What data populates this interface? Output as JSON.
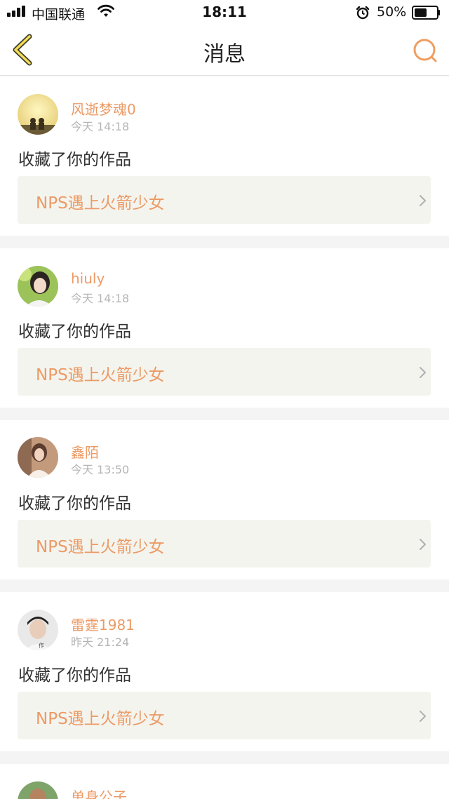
{
  "status_bar": {
    "carrier": "中国联通",
    "time": "18:11",
    "battery": "50%",
    "battery_level": 0.5
  },
  "nav": {
    "title": "消息",
    "back_icon": "back-chevron-icon",
    "search_icon": "search-icon"
  },
  "messages": [
    {
      "username": "风逝梦魂0",
      "time": "今天 14:18",
      "action": "收藏了你的作品",
      "work": "NPS遇上火箭少女"
    },
    {
      "username": "hiuly",
      "time": "今天 14:18",
      "action": "收藏了你的作品",
      "work": "NPS遇上火箭少女"
    },
    {
      "username": "鑫陌",
      "time": "今天 13:50",
      "action": "收藏了你的作品",
      "work": "NPS遇上火箭少女"
    },
    {
      "username": "雷霆1981",
      "time": "昨天 21:24",
      "action": "收藏了你的作品",
      "work": "NPS遇上火箭少女"
    },
    {
      "username": "单身公子",
      "time": "",
      "action": "",
      "work": ""
    }
  ],
  "colors": {
    "accent": "#ec9a65",
    "card_work_bg": "#f4f4ee",
    "page_bg": "#f4f4f4"
  }
}
